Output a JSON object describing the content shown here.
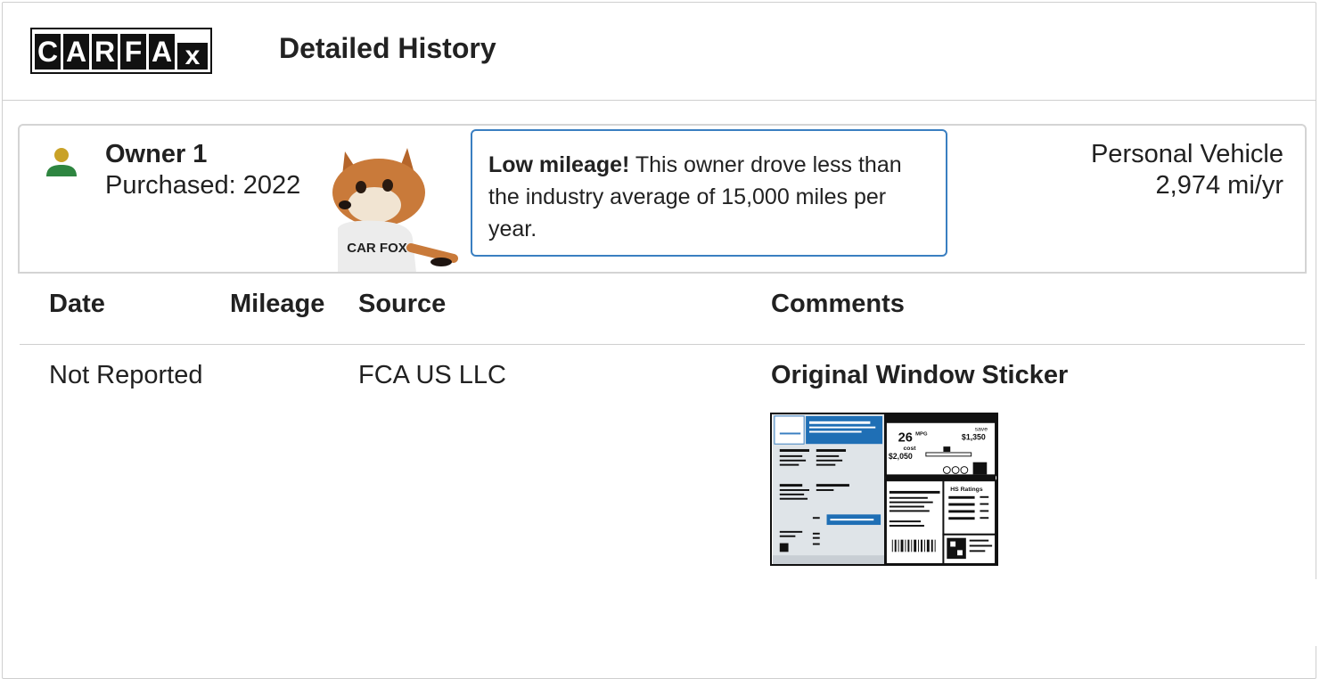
{
  "header": {
    "logo_letters": [
      "C",
      "A",
      "R",
      "F",
      "A",
      "x"
    ],
    "title": "Detailed History"
  },
  "owner": {
    "name": "Owner 1",
    "purchased": "Purchased: 2022",
    "icon": "person-icon",
    "vehicle_type": "Personal Vehicle",
    "annual_miles": "2,974 mi/yr",
    "mascot_shirt": "CAR FOX"
  },
  "callout": {
    "bold": "Low mileage!",
    "text": " This owner drove less than the industry average of 15,000 miles per year."
  },
  "table": {
    "columns": [
      "Date",
      "Mileage",
      "Source",
      "Comments"
    ],
    "rows": [
      {
        "date": "Not Reported",
        "mileage": "",
        "source": "FCA US LLC",
        "comment_title": "Original Window Sticker"
      }
    ]
  },
  "sticker": {
    "mpg": "26",
    "mpg_unit": "MPG",
    "you_save": "save",
    "save_amount": "$1,350",
    "fuel_cost_label": "cost",
    "fuel_cost": "$2,050",
    "ratings_label": "HS Ratings"
  },
  "colors": {
    "accent_blue": "#3a7fc1",
    "icon_head": "#c9a227",
    "icon_body": "#2e8540"
  }
}
